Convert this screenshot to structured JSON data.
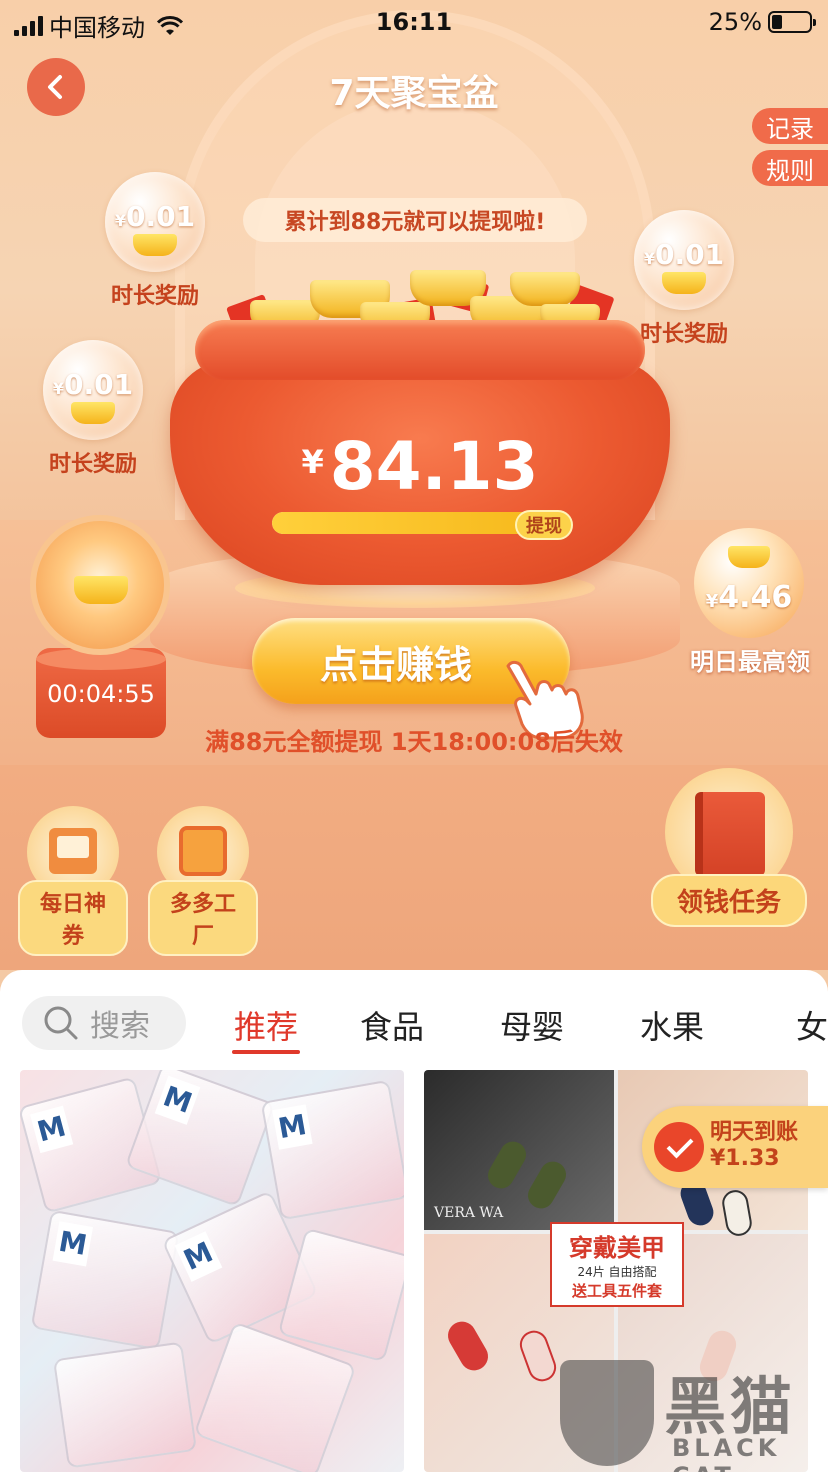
{
  "status_bar": {
    "carrier": "中国移动",
    "time": "16:11",
    "battery": "25%"
  },
  "header": {
    "title": "7天聚宝盆"
  },
  "side_tabs": {
    "records": "记录",
    "rules": "规则"
  },
  "goal_banner": "累计到88元就可以提现啦!",
  "bubbles": [
    {
      "amount": "0.01",
      "currency": "¥",
      "label": "时长奖励"
    },
    {
      "amount": "0.01",
      "currency": "¥",
      "label": "时长奖励"
    },
    {
      "amount": "0.01",
      "currency": "¥",
      "label": "时长奖励"
    }
  ],
  "pot": {
    "currency": "¥",
    "amount": "84.13",
    "progress_fraction": 0.95,
    "withdraw_label": "提现"
  },
  "timer": {
    "countdown": "00:04:55"
  },
  "tomorrow_max": {
    "currency": "¥",
    "amount": "4.46",
    "label": "明日最高领"
  },
  "earn_button": "点击赚钱",
  "expiry_notice": "满88元全额提现 1天18:00:08后失效",
  "features": {
    "daily_coupon": "每日神券",
    "factory": "多多工厂",
    "tasks": "领钱任务"
  },
  "feed": {
    "search_placeholder": "搜索",
    "tabs": [
      "推荐",
      "食品",
      "母婴",
      "水果",
      "女"
    ]
  },
  "product_right": {
    "title": "穿戴美甲",
    "subtitle": "24片 自由搭配",
    "promo": "送工具五件套",
    "brand_text": "VERA WA"
  },
  "product_left": {
    "brand_letter": "M"
  },
  "payout": {
    "line1": "明天到账",
    "line2": "¥1.33"
  },
  "watermark": {
    "cn": "黑猫",
    "en": "BLACK CAT"
  },
  "colors": {
    "accent_red": "#e0392b",
    "orange": "#f06b4a",
    "gold": "#fbbb2c"
  }
}
